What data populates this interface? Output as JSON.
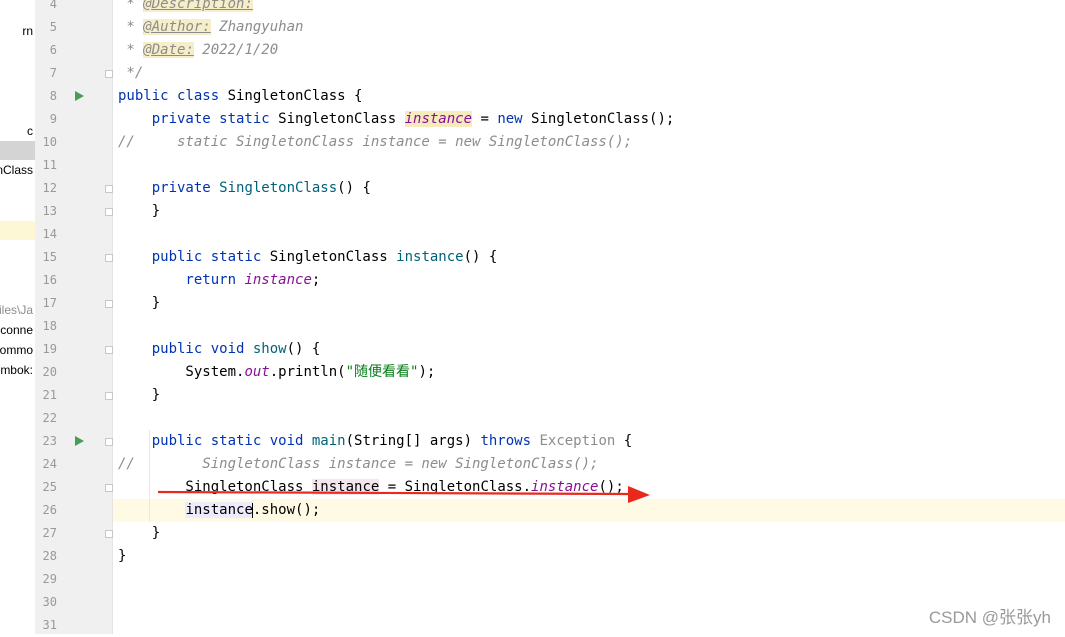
{
  "project_panel": {
    "items": [
      {
        "text": "rn",
        "style": ""
      },
      {
        "text": "c",
        "style": ""
      },
      {
        "text": "nClass",
        "style": ""
      },
      {
        "text": "Files\\Ja",
        "style": "gray"
      },
      {
        "text": "conne",
        "style": ""
      },
      {
        "text": "ommo",
        "style": ""
      },
      {
        "text": "mbok:",
        "style": ""
      }
    ]
  },
  "gutter": {
    "line_numbers": [
      "4",
      "5",
      "6",
      "7",
      "8",
      "9",
      "10",
      "11",
      "12",
      "13",
      "14",
      "15",
      "16",
      "17",
      "18",
      "19",
      "20",
      "21",
      "22",
      "23",
      "24",
      "25",
      "26",
      "27",
      "28",
      "29",
      "30",
      "31"
    ],
    "run_icon_lines": [
      8,
      23
    ],
    "fold_icon_lines": [
      7,
      12,
      13,
      15,
      17,
      19,
      21,
      23,
      25,
      27
    ]
  },
  "editor": {
    "caret_line": 26,
    "lines": [
      {
        "n": 4,
        "segs": [
          {
            "t": " * ",
            "c": "cmt"
          },
          {
            "t": "@Description:",
            "c": "tag"
          }
        ]
      },
      {
        "n": 5,
        "segs": [
          {
            "t": " * ",
            "c": "cmt"
          },
          {
            "t": "@Author:",
            "c": "tag"
          },
          {
            "t": " Zhangyuhan",
            "c": "cmt"
          }
        ]
      },
      {
        "n": 6,
        "segs": [
          {
            "t": " * ",
            "c": "cmt"
          },
          {
            "t": "@Date:",
            "c": "tag"
          },
          {
            "t": " 2022/1/20",
            "c": "cmt"
          }
        ]
      },
      {
        "n": 7,
        "segs": [
          {
            "t": " */",
            "c": "cmt"
          }
        ]
      },
      {
        "n": 8,
        "segs": [
          {
            "t": "public class ",
            "c": "kw"
          },
          {
            "t": "SingletonClass {",
            "c": ""
          }
        ]
      },
      {
        "n": 9,
        "segs": [
          {
            "t": "    private static ",
            "c": "kw"
          },
          {
            "t": "SingletonClass ",
            "c": ""
          },
          {
            "t": "instance",
            "c": "field hl-field"
          },
          {
            "t": " = ",
            "c": ""
          },
          {
            "t": "new ",
            "c": "kw"
          },
          {
            "t": "SingletonClass();",
            "c": ""
          }
        ]
      },
      {
        "n": 10,
        "segs": [
          {
            "t": "//     static SingletonClass instance = new SingletonClass();",
            "c": "cmt"
          }
        ]
      },
      {
        "n": 11,
        "segs": []
      },
      {
        "n": 12,
        "segs": [
          {
            "t": "    private ",
            "c": "kw"
          },
          {
            "t": "SingletonClass",
            "c": "fn"
          },
          {
            "t": "() {",
            "c": ""
          }
        ]
      },
      {
        "n": 13,
        "segs": [
          {
            "t": "    }",
            "c": ""
          }
        ]
      },
      {
        "n": 14,
        "segs": []
      },
      {
        "n": 15,
        "segs": [
          {
            "t": "    public static ",
            "c": "kw"
          },
          {
            "t": "SingletonClass ",
            "c": ""
          },
          {
            "t": "instance",
            "c": "fn"
          },
          {
            "t": "() {",
            "c": ""
          }
        ]
      },
      {
        "n": 16,
        "segs": [
          {
            "t": "        return ",
            "c": "kw"
          },
          {
            "t": "instance",
            "c": "field"
          },
          {
            "t": ";",
            "c": ""
          }
        ]
      },
      {
        "n": 17,
        "segs": [
          {
            "t": "    }",
            "c": ""
          }
        ]
      },
      {
        "n": 18,
        "segs": []
      },
      {
        "n": 19,
        "segs": [
          {
            "t": "    public void ",
            "c": "kw"
          },
          {
            "t": "show",
            "c": "fn"
          },
          {
            "t": "() {",
            "c": ""
          }
        ]
      },
      {
        "n": 20,
        "segs": [
          {
            "t": "        System.",
            "c": ""
          },
          {
            "t": "out",
            "c": "field"
          },
          {
            "t": ".println(",
            "c": ""
          },
          {
            "t": "\"随便看看\"",
            "c": "str"
          },
          {
            "t": ");",
            "c": ""
          }
        ]
      },
      {
        "n": 21,
        "segs": [
          {
            "t": "    }",
            "c": ""
          }
        ]
      },
      {
        "n": 22,
        "segs": []
      },
      {
        "n": 23,
        "segs": [
          {
            "t": "    public static void ",
            "c": "kw"
          },
          {
            "t": "main",
            "c": "fn"
          },
          {
            "t": "(String[] args) ",
            "c": ""
          },
          {
            "t": "throws ",
            "c": "kw"
          },
          {
            "t": "Exception",
            "c": "gray"
          },
          {
            "t": " {",
            "c": ""
          }
        ]
      },
      {
        "n": 24,
        "segs": [
          {
            "t": "//        SingletonClass instance = new SingletonClass();",
            "c": "cmt"
          }
        ]
      },
      {
        "n": 25,
        "segs": [
          {
            "t": "        SingletonClass ",
            "c": ""
          },
          {
            "t": "instance",
            "c": "hl-var"
          },
          {
            "t": " = SingletonClass.",
            "c": ""
          },
          {
            "t": "instance",
            "c": "field"
          },
          {
            "t": "();",
            "c": ""
          }
        ]
      },
      {
        "n": 26,
        "segs": [
          {
            "t": "        ",
            "c": ""
          },
          {
            "t": "instance",
            "c": "hl-sel"
          },
          {
            "t": "",
            "c": "caret"
          },
          {
            "t": ".show();",
            "c": ""
          }
        ]
      },
      {
        "n": 27,
        "segs": [
          {
            "t": "    }",
            "c": ""
          }
        ]
      },
      {
        "n": 28,
        "segs": [
          {
            "t": "}",
            "c": ""
          }
        ]
      },
      {
        "n": 29,
        "segs": []
      },
      {
        "n": 30,
        "segs": []
      },
      {
        "n": 31,
        "segs": []
      }
    ]
  },
  "annotation": {
    "arrow_color": "#e8291c"
  },
  "watermark": "CSDN @张张yh"
}
